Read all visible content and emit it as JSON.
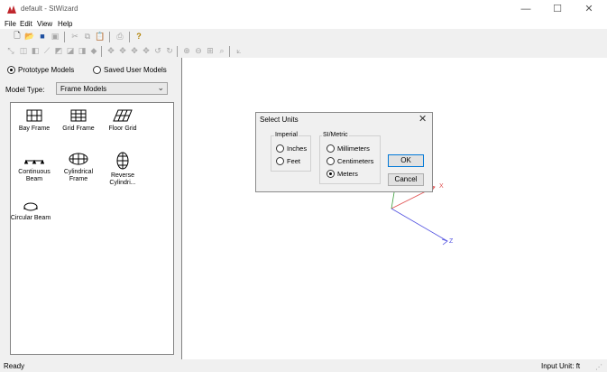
{
  "window": {
    "title": "default - StWizard",
    "controls": {
      "minimize": "—",
      "maximize": "☐",
      "close": "✕"
    }
  },
  "menu": [
    "File",
    "Edit",
    "View",
    "Help"
  ],
  "left_panel": {
    "radio_prototype": "Prototype Models",
    "radio_saved": "Saved User Models",
    "selected_source": "Prototype Models",
    "model_type_label": "Model Type:",
    "model_type_value": "Frame Models",
    "models": [
      {
        "label1": "Bay Frame",
        "label2": "",
        "icon": "bay-frame-icon"
      },
      {
        "label1": "Grid Frame",
        "label2": "",
        "icon": "grid-frame-icon"
      },
      {
        "label1": "Floor Grid",
        "label2": "",
        "icon": "floor-grid-icon"
      },
      {
        "label1": "Continuous",
        "label2": "Beam",
        "icon": "continuous-beam-icon"
      },
      {
        "label1": "Cylindrical",
        "label2": "Frame",
        "icon": "cylindrical-frame-icon"
      },
      {
        "label1": "Reverse",
        "label2": "Cylindri...",
        "icon": "reverse-cylindrical-icon"
      },
      {
        "label1": "Circular Beam",
        "label2": "",
        "icon": "circular-beam-icon"
      }
    ]
  },
  "dialog": {
    "title": "Select Units",
    "imperial_group": "Imperial",
    "imperial_options": [
      "Inches",
      "Feet"
    ],
    "si_group": "SI/Metric",
    "si_options": [
      "Millimeters",
      "Centimeters",
      "Meters"
    ],
    "selected": "Meters",
    "ok": "OK",
    "cancel": "Cancel"
  },
  "axes": {
    "x_label": "X",
    "z_label": "Z",
    "x_color": "#e05050",
    "z_color": "#5050e0",
    "y_color": "#40a040"
  },
  "status": {
    "text": "Ready",
    "input_unit": "Input Unit:  ft"
  },
  "colors": {
    "accent": "#0078d7",
    "app_icon": "#c0272d"
  }
}
